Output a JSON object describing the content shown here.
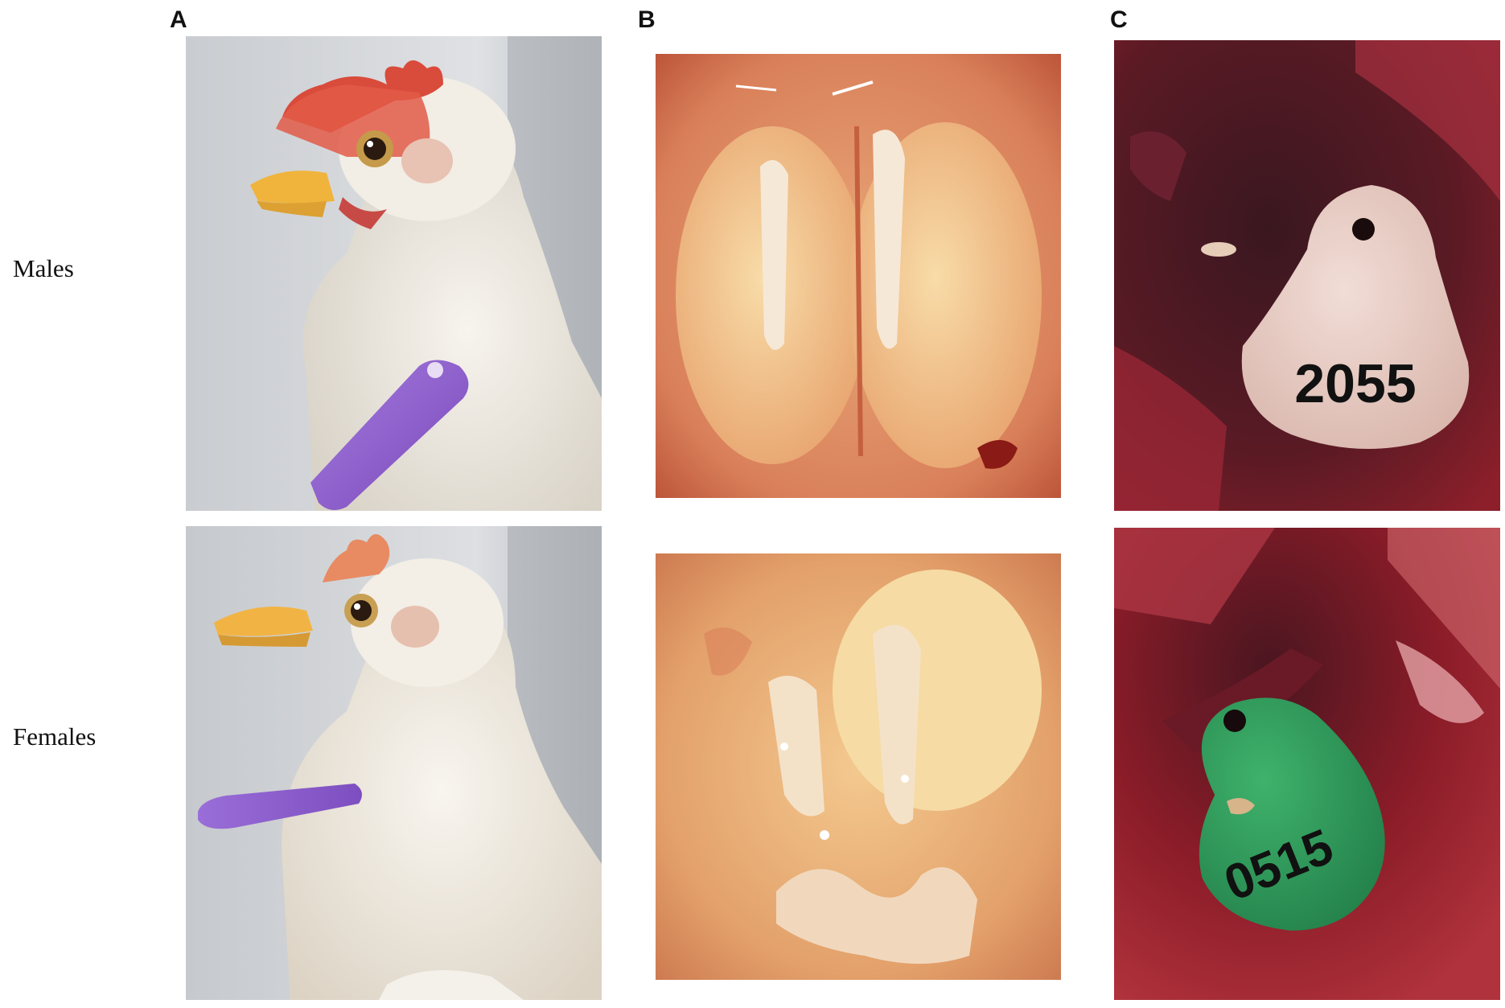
{
  "panels": {
    "a": "A",
    "b": "B",
    "c": "C"
  },
  "rows": {
    "males": "Males",
    "females": "Females"
  },
  "tags": {
    "male_tag": "2055",
    "female_tag": "0515"
  },
  "colors": {
    "background": "#ffffff",
    "wing_tag_purple": "#8a5cc8",
    "leg_tag_green": "#2f9e5c",
    "leg_tag_pale": "#e9d3cc",
    "tissue_red": "#8a1a22",
    "gonad_cream": "#f3d6a3"
  }
}
